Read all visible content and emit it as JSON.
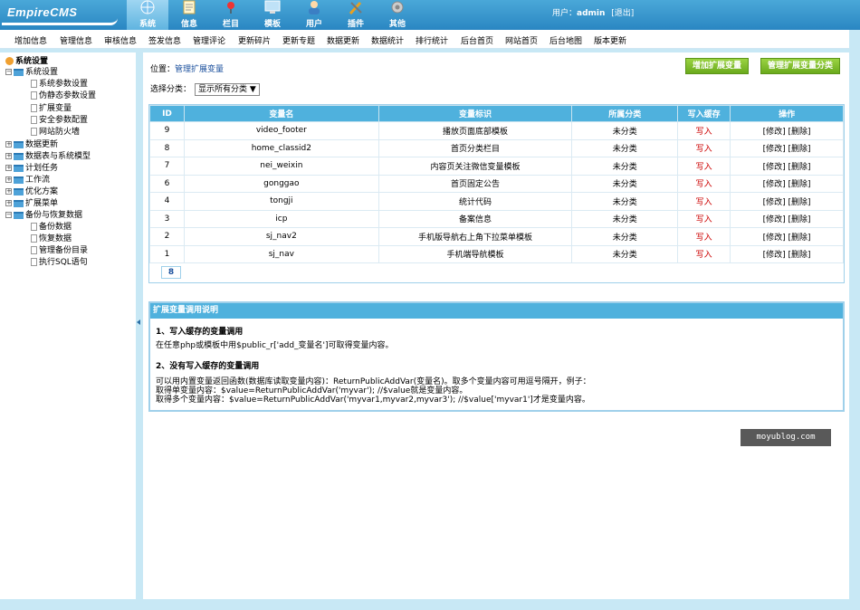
{
  "header": {
    "logo_text": "EmpireCMS",
    "tabs": [
      {
        "label": "系统",
        "icon": "globe-icon",
        "active": true
      },
      {
        "label": "信息",
        "icon": "notepad-icon",
        "active": false
      },
      {
        "label": "栏目",
        "icon": "pushpin-icon",
        "active": false
      },
      {
        "label": "模板",
        "icon": "monitor-icon",
        "active": false
      },
      {
        "label": "用户",
        "icon": "user-icon",
        "active": false
      },
      {
        "label": "插件",
        "icon": "tools-icon",
        "active": false
      },
      {
        "label": "其他",
        "icon": "gear-icon",
        "active": false
      }
    ],
    "user_label": "用户：",
    "username": "admin",
    "logout": "[退出]"
  },
  "menu": [
    "增加信息",
    "管理信息",
    "审核信息",
    "签发信息",
    "管理评论",
    "更新碎片",
    "更新专题",
    "数据更新",
    "数据统计",
    "排行统计",
    "后台首页",
    "网站首页",
    "后台地图",
    "版本更新"
  ],
  "sidebar": {
    "root": "系统设置",
    "items": [
      {
        "label": "系统设置",
        "type": "folder-open"
      },
      {
        "label": "系统参数设置",
        "type": "doc"
      },
      {
        "label": "伪静态参数设置",
        "type": "doc"
      },
      {
        "label": "扩展变量",
        "type": "doc"
      },
      {
        "label": "安全参数配置",
        "type": "doc"
      },
      {
        "label": "网站防火墙",
        "type": "doc"
      },
      {
        "label": "数据更新",
        "type": "folder"
      },
      {
        "label": "数据表与系统模型",
        "type": "folder"
      },
      {
        "label": "计划任务",
        "type": "folder"
      },
      {
        "label": "工作流",
        "type": "folder"
      },
      {
        "label": "优化方案",
        "type": "folder"
      },
      {
        "label": "扩展菜单",
        "type": "folder"
      },
      {
        "label": "备份与恢复数据",
        "type": "folder-open"
      },
      {
        "label": "备份数据",
        "type": "doc"
      },
      {
        "label": "恢复数据",
        "type": "doc"
      },
      {
        "label": "管理备份目录",
        "type": "doc"
      },
      {
        "label": "执行SQL语句",
        "type": "doc"
      }
    ]
  },
  "main": {
    "position_label": "位置：",
    "position_link": "管理扩展变量",
    "btn_add": "增加扩展变量",
    "btn_manage_class": "管理扩展变量分类",
    "filter_label": "选择分类：",
    "filter_value": "显示所有分类 ▼",
    "columns": [
      "ID",
      "变量名",
      "变量标识",
      "所属分类",
      "写入缓存",
      "操作"
    ],
    "rows": [
      {
        "id": "9",
        "name": "video_footer",
        "mark": "播放页面底部模板",
        "cat": "未分类",
        "cache": "写入",
        "ops": "[修改] [删除]"
      },
      {
        "id": "8",
        "name": "home_classid2",
        "mark": "首页分类栏目",
        "cat": "未分类",
        "cache": "写入",
        "ops": "[修改] [删除]"
      },
      {
        "id": "7",
        "name": "nei_weixin",
        "mark": "内容页关注微信变量模板",
        "cat": "未分类",
        "cache": "写入",
        "ops": "[修改] [删除]"
      },
      {
        "id": "6",
        "name": "gonggao",
        "mark": "首页固定公告",
        "cat": "未分类",
        "cache": "写入",
        "ops": "[修改] [删除]"
      },
      {
        "id": "4",
        "name": "tongji",
        "mark": "统计代码",
        "cat": "未分类",
        "cache": "写入",
        "ops": "[修改] [删除]"
      },
      {
        "id": "3",
        "name": "icp",
        "mark": "备案信息",
        "cat": "未分类",
        "cache": "写入",
        "ops": "[修改] [删除]"
      },
      {
        "id": "2",
        "name": "sj_nav2",
        "mark": "手机版导航右上角下拉菜单模板",
        "cat": "未分类",
        "cache": "写入",
        "ops": "[修改] [删除]"
      },
      {
        "id": "1",
        "name": "sj_nav",
        "mark": "手机端导航模板",
        "cat": "未分类",
        "cache": "写入",
        "ops": "[修改] [删除]"
      }
    ],
    "pager": "8",
    "help": {
      "title": "扩展变量调用说明",
      "h1": "1、写入缓存的变量调用",
      "p1": "在任意php或模板中用$public_r['add_变量名']可取得变量内容。",
      "h2": "2、没有写入缓存的变量调用",
      "p2": "可以用内置变量返回函数(数据库读取变量内容)：ReturnPublicAddVar(变量名)。取多个变量内容可用逗号隔开，例子：",
      "p3": "取得单变量内容：$value=ReturnPublicAddVar('myvar'); //$value就是变量内容。",
      "p4": "取得多个变量内容：$value=ReturnPublicAddVar('myvar1,myvar2,myvar3'); //$value['myvar1']才是变量内容。"
    }
  },
  "watermark": "moyublog.com",
  "colors": {
    "header": "#2a86c2",
    "table_head": "#4fb1dd",
    "button_green": "#6aaa1c",
    "write_red": "#cc0000"
  }
}
